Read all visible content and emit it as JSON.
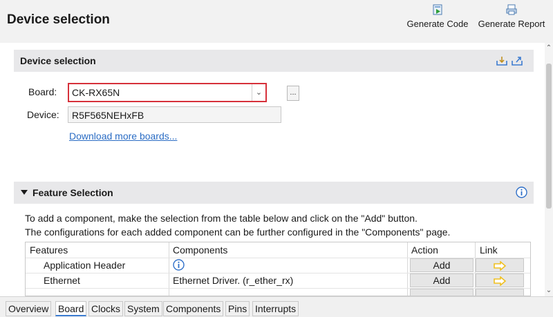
{
  "header": {
    "title": "Device selection",
    "generate_code": "Generate Code",
    "generate_report": "Generate Report"
  },
  "device_section": {
    "title": "Device selection",
    "board_label": "Board:",
    "board_value": "CK-RX65N",
    "browse_label": "...",
    "device_label": "Device:",
    "device_value": "R5F565NEHxFB",
    "download_link": "Download more boards..."
  },
  "feature_section": {
    "title": "Feature Selection",
    "desc_line1": "To add a component, make the selection from the table below and click on the \"Add\" button.",
    "desc_line2": "The configurations for each added component can be further configured in the \"Components\" page.",
    "columns": [
      "Features",
      "Components",
      "Action",
      "Link"
    ],
    "rows": [
      {
        "feature": "Application Header",
        "component": "",
        "component_icon": "info-icon",
        "action": "Add"
      },
      {
        "feature": "Ethernet",
        "component": "Ethernet Driver. (r_ether_rx)",
        "action": "Add"
      }
    ]
  },
  "tabs": [
    "Overview",
    "Board",
    "Clocks",
    "System",
    "Components",
    "Pins",
    "Interrupts"
  ],
  "active_tab": "Board",
  "colors": {
    "accent": "#3b7bd0",
    "highlight_border": "#d6303a",
    "link": "#2a6cc4",
    "info": "#2f6fc8",
    "arrow": "#f0c020"
  }
}
